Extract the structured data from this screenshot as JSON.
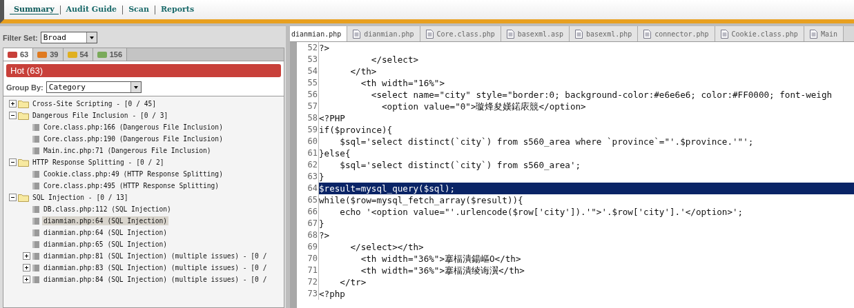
{
  "nav": [
    {
      "label": "Summary",
      "selected": true
    },
    {
      "label": "Audit Guide",
      "selected": false
    },
    {
      "label": "Scan",
      "selected": false
    },
    {
      "label": "Reports",
      "selected": false
    }
  ],
  "filter_set": {
    "label": "Filter Set:",
    "value": "Broad"
  },
  "severity_tabs": [
    {
      "count": "63",
      "color": "#c8403a",
      "selected": true
    },
    {
      "count": "39",
      "color": "#e07a20",
      "selected": false
    },
    {
      "count": "54",
      "color": "#e0b020",
      "selected": false
    },
    {
      "count": "156",
      "color": "#7aaa5a",
      "selected": false
    }
  ],
  "hot_bar": {
    "label": "Hot (63)"
  },
  "group_by": {
    "label": "Group By:",
    "value": "Category"
  },
  "tree": [
    {
      "kind": "folder",
      "label": "Cross-Site Scripting - [0 / 45]",
      "expanded": false,
      "selected": false
    },
    {
      "kind": "folder",
      "label": "Dangerous File Inclusion - [0 / 3]",
      "expanded": true,
      "selected": false,
      "children": [
        {
          "kind": "file",
          "label": "Core.class.php:166 (Dangerous File Inclusion)",
          "selected": false
        },
        {
          "kind": "file",
          "label": "Core.class.php:190 (Dangerous File Inclusion)",
          "selected": false
        },
        {
          "kind": "file",
          "label": "Main.inc.php:71 (Dangerous File Inclusion)",
          "selected": false
        }
      ]
    },
    {
      "kind": "folder",
      "label": "HTTP Response Splitting - [0 / 2]",
      "expanded": true,
      "selected": false,
      "children": [
        {
          "kind": "file",
          "label": "Cookie.class.php:49 (HTTP Response Splitting)",
          "selected": false
        },
        {
          "kind": "file",
          "label": "Core.class.php:495 (HTTP Response Splitting)",
          "selected": false
        }
      ]
    },
    {
      "kind": "folder",
      "label": "SQL Injection - [0 / 13]",
      "expanded": true,
      "selected": false,
      "children": [
        {
          "kind": "file",
          "label": "DB.class.php:112 (SQL Injection)",
          "selected": false
        },
        {
          "kind": "file",
          "label": "dianmian.php:64 (SQL Injection)",
          "selected": true
        },
        {
          "kind": "file",
          "label": "dianmian.php:64 (SQL Injection)",
          "selected": false
        },
        {
          "kind": "file",
          "label": "dianmian.php:65 (SQL Injection)",
          "selected": false
        },
        {
          "kind": "file",
          "label": "dianmian.php:81 (SQL Injection) (multiple issues) - [0 /",
          "expanded": false,
          "selected": false
        },
        {
          "kind": "file",
          "label": "dianmian.php:83 (SQL Injection) (multiple issues) - [0 /",
          "expanded": false,
          "selected": false
        },
        {
          "kind": "file",
          "label": "dianmian.php:84 (SQL Injection) (multiple issues) - [0 /",
          "expanded": false,
          "selected": false
        }
      ]
    }
  ],
  "editor_tabs": [
    {
      "label": "dianmian.php",
      "selected": true
    },
    {
      "label": "dianmian.php",
      "selected": false
    },
    {
      "label": "Core.class.php",
      "selected": false
    },
    {
      "label": "basexml.asp",
      "selected": false
    },
    {
      "label": "basexml.php",
      "selected": false
    },
    {
      "label": "connector.php",
      "selected": false
    },
    {
      "label": "Cookie.class.php",
      "selected": false
    },
    {
      "label": "Main",
      "selected": false
    }
  ],
  "code_lines": [
    {
      "number": "52",
      "text": "?>",
      "selected": false
    },
    {
      "number": "53",
      "text": "          </select>",
      "selected": false
    },
    {
      "number": "54",
      "text": "      </th>",
      "selected": false
    },
    {
      "number": "55",
      "text": "        <th width=\"16%\">",
      "selected": false
    },
    {
      "number": "56",
      "text": "          <select name=\"city\" style=\"border:0; background-color:#e6e6e6; color:#FF0000; font-weigh",
      "selected": false
    },
    {
      "number": "57",
      "text": "            <option value=\"0\">璇烽夋嫨鍩庡競</option>",
      "selected": false
    },
    {
      "number": "58",
      "text": "<?PHP",
      "selected": false
    },
    {
      "number": "59",
      "text": "if($province){",
      "selected": false
    },
    {
      "number": "60",
      "text": "    $sql='select distinct(`city`) from s560_area where `province`=\"'.$province.'\"';",
      "selected": false
    },
    {
      "number": "61",
      "text": "}else{",
      "selected": false
    },
    {
      "number": "62",
      "text": "    $sql='select distinct(`city`) from s560_area';",
      "selected": false
    },
    {
      "number": "63",
      "text": "}",
      "selected": false
    },
    {
      "number": "64",
      "text": "$result=mysql_query($sql);",
      "selected": true
    },
    {
      "number": "65",
      "text": "while($row=mysql_fetch_array($result)){",
      "selected": false
    },
    {
      "number": "66",
      "text": "    echo '<option value=\"'.urlencode($row['city']).'\">'.$row['city'].'</option>';",
      "selected": false
    },
    {
      "number": "67",
      "text": "}",
      "selected": false
    },
    {
      "number": "68",
      "text": "?>",
      "selected": false
    },
    {
      "number": "69",
      "text": "      </select></th>",
      "selected": false
    },
    {
      "number": "70",
      "text": "        <th width=\"36%\">搴楅潰鍚嶇О</th>",
      "selected": false
    },
    {
      "number": "71",
      "text": "        <th width=\"36%\">搴楅潰绫诲瀷</th>",
      "selected": false
    },
    {
      "number": "72",
      "text": "    </tr>",
      "selected": false
    },
    {
      "number": "73",
      "text": "<?php",
      "selected": false
    }
  ]
}
